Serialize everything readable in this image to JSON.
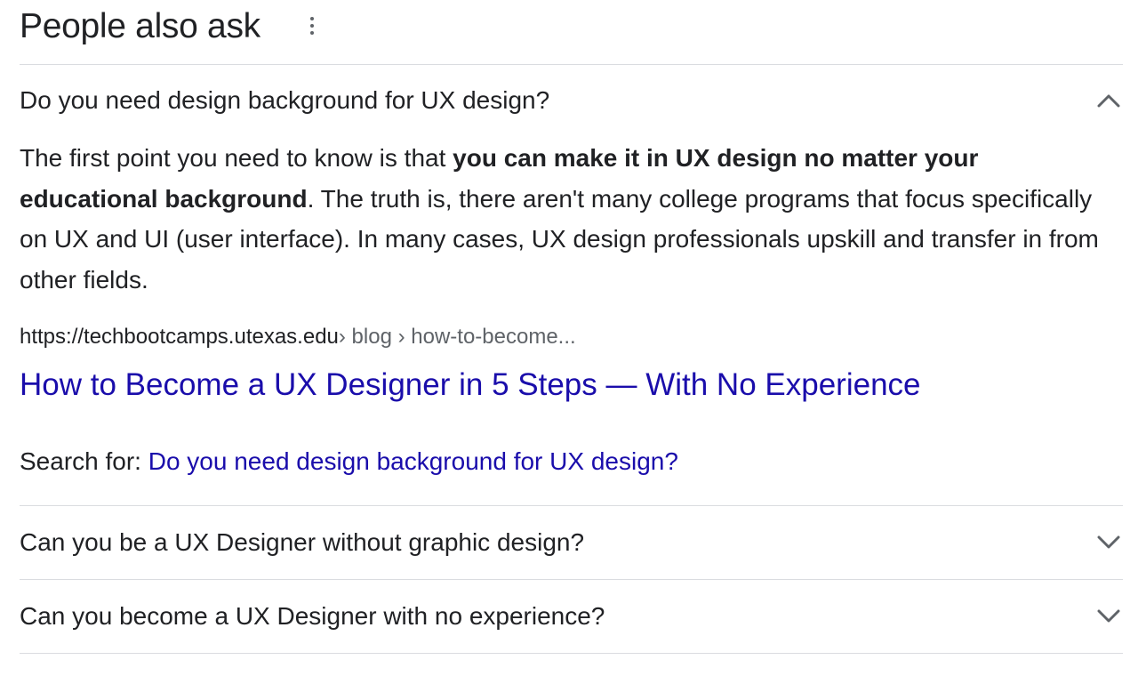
{
  "paa": {
    "title": "People also ask",
    "more_icon": "more-vert-icon",
    "questions": [
      {
        "question": "Do you need design background for UX design?",
        "expanded": true,
        "chevron_icon": "chevron-up-icon",
        "answer_prefix": "The first point you need to know is that ",
        "answer_bold": "you can make it in UX design no matter your educational background",
        "answer_suffix": ". The truth is, there aren't many college programs that focus specifically on UX and UI (user interface). In many cases, UX design professionals upskill and transfer in from other fields.",
        "source_domain": "https://techbootcamps.utexas.edu",
        "source_breadcrumbs": " › blog › how-to-become...",
        "source_title": "How to Become a UX Designer in 5 Steps — With No Experience",
        "search_for_label": "Search for: ",
        "search_for_query": "Do you need design background for UX design?"
      },
      {
        "question": "Can you be a UX Designer without graphic design?",
        "expanded": false,
        "chevron_icon": "chevron-down-icon"
      },
      {
        "question": "Can you become a UX Designer with no experience?",
        "expanded": false,
        "chevron_icon": "chevron-down-icon"
      }
    ]
  },
  "colors": {
    "text": "#202124",
    "link": "#1a0dab",
    "secondary": "#5f6368",
    "divider": "#dadce0"
  }
}
